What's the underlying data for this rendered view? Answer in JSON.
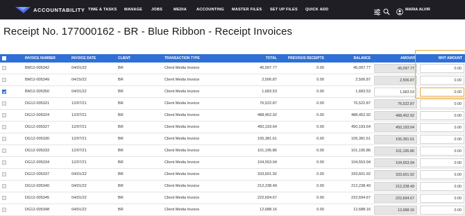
{
  "app": {
    "brand": "ACCOUNTABILITY",
    "nav": [
      "TIME & TASKS",
      "MANAGE",
      "JOBS",
      "MEDIA",
      "ACCOUNTING",
      "MASTER FILES",
      "SET UP FILES",
      "QUICK ADD"
    ],
    "user": "MARIA ALVIR"
  },
  "page": {
    "title": "Receipt No. 177000162 - BR - Blue Ribbon - Receipt Invoices"
  },
  "table": {
    "columns": [
      "INVOICE NUMBER",
      "INVOICE DATE",
      "CLIENT",
      "TRANSACTION TYPE",
      "TOTAL",
      "PREVIOUS RECEIPTS",
      "BALANCE",
      "AMOUNT",
      "WHT AMOUNT"
    ],
    "rows": [
      {
        "checked": false,
        "invoice": "BM12-005342",
        "date": "04/01/22",
        "client": "BR",
        "type": "Client Media Invoice",
        "total": "45,097.77",
        "prev": "0.00",
        "balance": "45,097.77",
        "amount": "45,097.77",
        "wht": "0.00"
      },
      {
        "checked": false,
        "invoice": "BM12-005349",
        "date": "04/15/22",
        "client": "BR",
        "type": "Client Media Invoice",
        "total": "2,506.87",
        "prev": "0.00",
        "balance": "2,506.87",
        "amount": "2,506.87",
        "wht": "0.00"
      },
      {
        "checked": true,
        "invoice": "BM12-005350",
        "date": "04/01/22",
        "client": "BR",
        "type": "Client Media Invoice",
        "total": "1,683.53",
        "prev": "0.00",
        "balance": "1,683.53",
        "amount": "1,683.53",
        "wht": "0.00"
      },
      {
        "checked": false,
        "invoice": "DG12-005321",
        "date": "12/07/21",
        "client": "BR",
        "type": "Client Media Invoice",
        "total": "76,522.87",
        "prev": "0.00",
        "balance": "76,522.87",
        "amount": "76,522.87",
        "wht": "0.00"
      },
      {
        "checked": false,
        "invoice": "DG12-005324",
        "date": "12/07/21",
        "client": "BR",
        "type": "Client Media Invoice",
        "total": "488,452.92",
        "prev": "0.00",
        "balance": "488,452.92",
        "amount": "488,452.92",
        "wht": "0.00"
      },
      {
        "checked": false,
        "invoice": "DG12-005327",
        "date": "12/07/21",
        "client": "BR",
        "type": "Client Media Invoice",
        "total": "450,193.64",
        "prev": "0.00",
        "balance": "450,193.64",
        "amount": "450,193.64",
        "wht": "0.00"
      },
      {
        "checked": false,
        "invoice": "DG12-005330",
        "date": "12/07/21",
        "client": "BR",
        "type": "Client Media Invoice",
        "total": "105,381.61",
        "prev": "0.00",
        "balance": "105,381.61",
        "amount": "105,381.61",
        "wht": "0.00"
      },
      {
        "checked": false,
        "invoice": "DG12-005333",
        "date": "12/07/21",
        "client": "BR",
        "type": "Client Media Invoice",
        "total": "101,195.86",
        "prev": "0.00",
        "balance": "101,195.86",
        "amount": "101,195.86",
        "wht": "0.00"
      },
      {
        "checked": false,
        "invoice": "DG12-005334",
        "date": "12/07/21",
        "client": "BR",
        "type": "Client Media Invoice",
        "total": "104,553.94",
        "prev": "0.00",
        "balance": "104,553.94",
        "amount": "104,553.94",
        "wht": "0.00"
      },
      {
        "checked": false,
        "invoice": "DG12-005337",
        "date": "04/01/22",
        "client": "BR",
        "type": "Client Media Invoice",
        "total": "333,601.92",
        "prev": "0.00",
        "balance": "333,601.92",
        "amount": "333,601.92",
        "wht": "0.00"
      },
      {
        "checked": false,
        "invoice": "DG12-005340",
        "date": "04/01/22",
        "client": "BR",
        "type": "Client Media Invoice",
        "total": "212,238.49",
        "prev": "0.00",
        "balance": "212,238.49",
        "amount": "212,238.49",
        "wht": "0.00"
      },
      {
        "checked": false,
        "invoice": "DG12-005345",
        "date": "04/01/22",
        "client": "BR",
        "type": "Client Media Invoice",
        "total": "222,694.67",
        "prev": "0.00",
        "balance": "222,694.67",
        "amount": "222,694.67",
        "wht": "0.00"
      },
      {
        "checked": false,
        "invoice": "DG12-005348",
        "date": "04/01/22",
        "client": "BR",
        "type": "Client Media Invoice",
        "total": "12,688.16",
        "prev": "0.00",
        "balance": "12,688.16",
        "amount": "12,688.16",
        "wht": "0.00"
      }
    ]
  },
  "colors": {
    "topbar": "#1e1e24",
    "header": "#2f6fd6",
    "focus": "#e8a93a"
  },
  "icons": [
    "accountability-logo-icon",
    "filter-icon",
    "search-icon",
    "user-avatar-icon",
    "checkbox-icon"
  ]
}
